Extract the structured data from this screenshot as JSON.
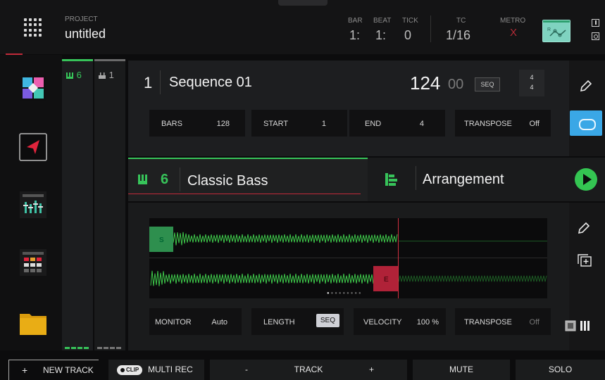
{
  "header": {
    "project_label": "PROJECT",
    "project_name": "untitled",
    "bar_label": "BAR",
    "bar_value": "1:",
    "beat_label": "BEAT",
    "beat_value": "1:",
    "tick_label": "TICK",
    "tick_value": "0",
    "tc_label": "TC",
    "tc_value": "1/16",
    "metro_label": "METRO",
    "metro_state": "X",
    "automation_glyph": "R"
  },
  "tracks_strip": [
    {
      "number": "6",
      "icon": "keys-icon",
      "color": "#37c45a"
    },
    {
      "number": "1",
      "icon": "drum-icon",
      "color": "#aaaaaa"
    }
  ],
  "sequence": {
    "number": "1",
    "name": "Sequence 01",
    "bpm": "124",
    "bpm_decimal": "00",
    "bpm_mode": "SEQ",
    "time_sig_top": "4",
    "time_sig_bottom": "4",
    "params": [
      {
        "key": "BARS",
        "value": "128"
      },
      {
        "key": "START",
        "value": "1"
      },
      {
        "key": "END",
        "value": "4"
      },
      {
        "key": "TRANSPOSE",
        "value": "Off"
      }
    ]
  },
  "track": {
    "number": "6",
    "name": "Classic Bass",
    "view": "Arrangement",
    "marker_start": "S",
    "marker_end": "E",
    "params": [
      {
        "key": "MONITOR",
        "value": "Auto"
      },
      {
        "key": "LENGTH",
        "value": "SEQ"
      },
      {
        "key": "VELOCITY",
        "value": "100 %"
      },
      {
        "key": "TRANSPOSE",
        "value": "Off"
      }
    ]
  },
  "bottom": {
    "new_track": "NEW TRACK",
    "new_track_plus": "+",
    "clip_badge": "CLIP",
    "multi_rec": "MULTI REC",
    "track_minus": "-",
    "track_label": "TRACK",
    "track_plus": "+",
    "mute": "MUTE",
    "solo": "SOLO"
  },
  "colors": {
    "accent_green": "#37c45a",
    "accent_red": "#c22a3a",
    "loop_blue": "#3aa7e6"
  }
}
